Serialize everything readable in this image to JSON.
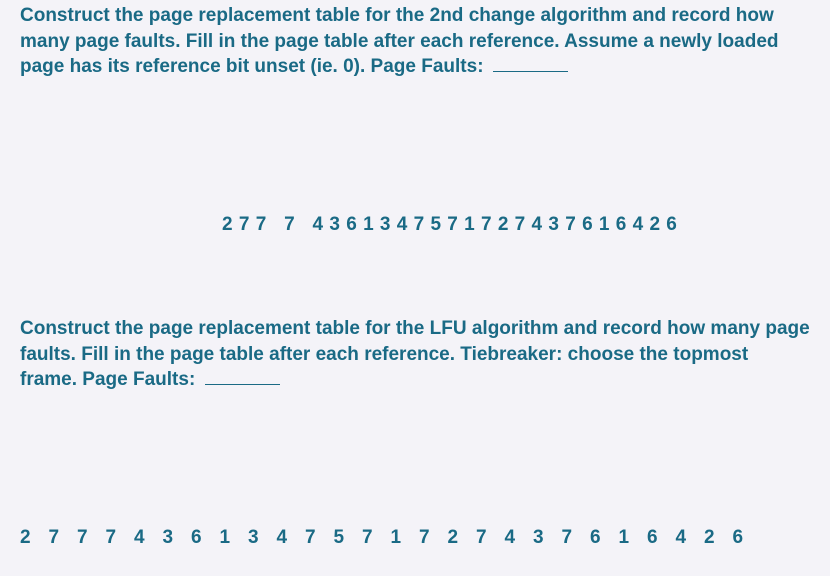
{
  "question1": {
    "text": "Construct the page replacement table for the 2nd change algorithm and record how many page faults. Fill in the page table after each reference. Assume a newly loaded page has its reference bit unset (ie. 0). Page Faults:",
    "reference_string_groups": [
      "2 7 7",
      "7",
      "4 3 6 1 3 4 7 5 7 1 7 2 7 4 3 7 6 1 6 4 2 6"
    ]
  },
  "question2": {
    "text": "Construct the page replacement table for the LFU algorithm and record how many page faults. Fill in the page table after each reference. Tiebreaker: choose the topmost frame. Page Faults:",
    "reference_string": [
      "2",
      "7",
      "7",
      "7",
      "4",
      "3",
      "6",
      "1",
      "3",
      "4",
      "7",
      "5",
      "7",
      "1",
      "7",
      "2",
      "7",
      "4",
      "3",
      "7",
      "6",
      "1",
      "6",
      "4",
      "2",
      "6"
    ]
  }
}
